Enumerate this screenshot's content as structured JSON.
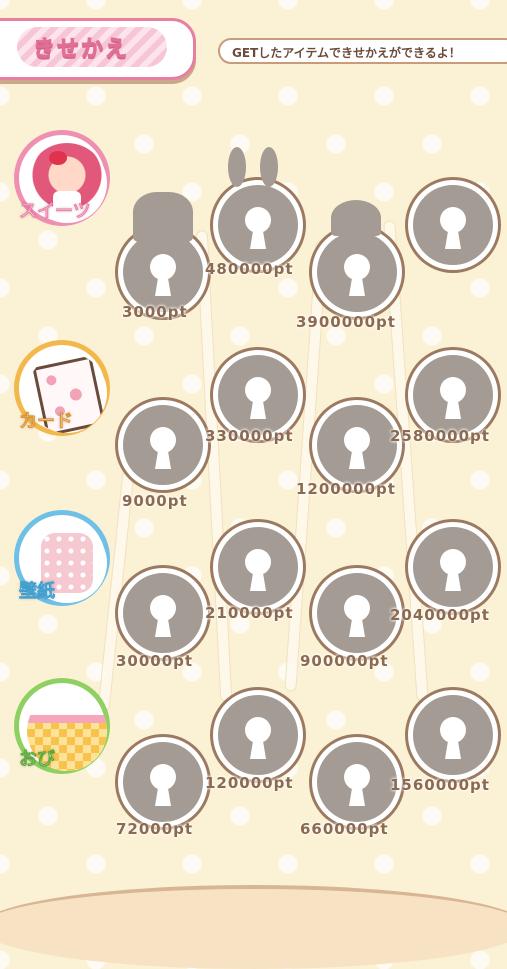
{
  "header": {
    "title": "きせかえ",
    "hint": "GETしたアイテムできせかえができるよ！"
  },
  "categories": [
    {
      "label": "スイーツ",
      "ring": "#ef8fb2",
      "label_color": "#f59ab7"
    },
    {
      "label": "カード",
      "ring": "#f2b84c",
      "label_color": "#f2a83a"
    },
    {
      "label": "壁紙",
      "ring": "#6fc0e6",
      "label_color": "#5ab4e0"
    },
    {
      "label": "おび",
      "ring": "#8fd063",
      "label_color": "#72c24a"
    }
  ],
  "rows": [
    {
      "prices": [
        "3000pt",
        "480000pt",
        "3900000pt"
      ]
    },
    {
      "prices": [
        "9000pt",
        "330000pt",
        "1200000pt",
        "2580000pt"
      ]
    },
    {
      "prices": [
        "30000pt",
        "210000pt",
        "900000pt",
        "2040000pt"
      ]
    },
    {
      "prices": [
        "72000pt",
        "120000pt",
        "660000pt",
        "1560000pt"
      ]
    }
  ]
}
